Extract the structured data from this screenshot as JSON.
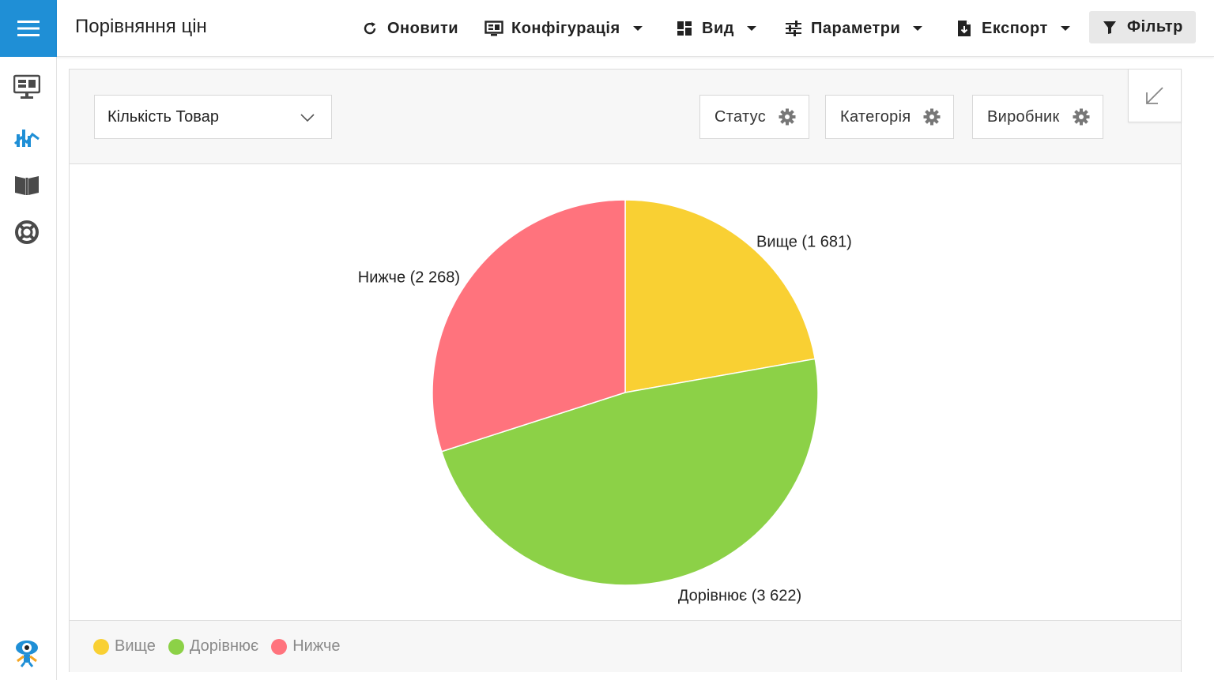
{
  "app": {
    "title": "Порівняння цін"
  },
  "toolbar": {
    "refresh_label": "Оновити",
    "config_label": "Конфігурація",
    "view_label": "Вид",
    "params_label": "Параметри",
    "export_label": "Експорт",
    "filter_label": "Фільтр"
  },
  "controls": {
    "measure_select": "Кількість Товар",
    "chips": [
      "Статус",
      "Категорія",
      "Виробник"
    ]
  },
  "sidebar": {
    "items": [
      "monitor-icon",
      "chart-icon",
      "book-icon",
      "lifebuoy-icon"
    ],
    "bottom": "mascot-icon"
  },
  "colors": {
    "accent": "#1f8fd6",
    "above": "#f9d033",
    "equal": "#8cd147",
    "below": "#ff737d"
  },
  "chart_data": {
    "type": "pie",
    "title": "",
    "categories": [
      "Вище",
      "Дорівнює",
      "Нижче"
    ],
    "values": [
      1681,
      3622,
      2268
    ],
    "labels": [
      "Вище (1 681)",
      "Дорівнює (3 622)",
      "Нижче (2 268)"
    ],
    "colors": [
      "#f9d033",
      "#8cd147",
      "#ff737d"
    ],
    "legend": "bottom-left"
  }
}
